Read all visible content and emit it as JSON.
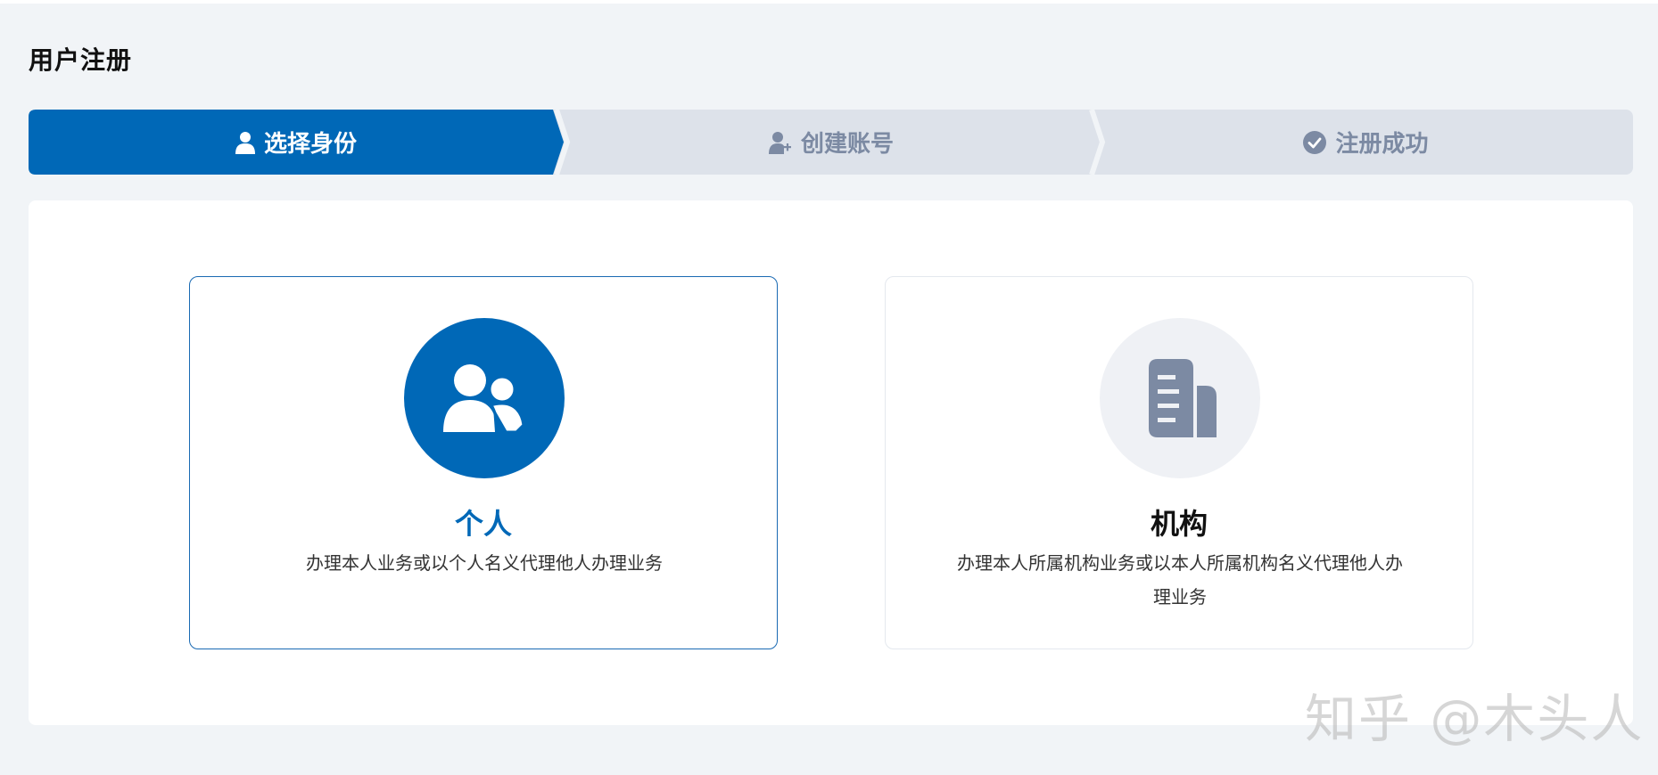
{
  "page": {
    "title": "用户注册"
  },
  "stepper": {
    "steps": [
      {
        "label": "选择身份",
        "icon": "user-icon",
        "state": "active"
      },
      {
        "label": "创建账号",
        "icon": "user-add-icon",
        "state": "inactive"
      },
      {
        "label": "注册成功",
        "icon": "check-circle-icon",
        "state": "inactive"
      }
    ]
  },
  "cards": [
    {
      "title": "个人",
      "description": "办理本人业务或以个人名义代理他人办理业务",
      "icon": "users-icon",
      "selected": true
    },
    {
      "title": "机构",
      "description": "办理本人所属机构业务或以本人所属机构名义代理他人办理业务",
      "icon": "building-icon",
      "selected": false
    }
  ],
  "watermark": "知乎 @木头人",
  "colors": {
    "primary": "#0068b7",
    "inactive_step_bg": "#dde2ea",
    "inactive_text": "#7c8aa3",
    "page_bg": "#f1f4f7"
  }
}
